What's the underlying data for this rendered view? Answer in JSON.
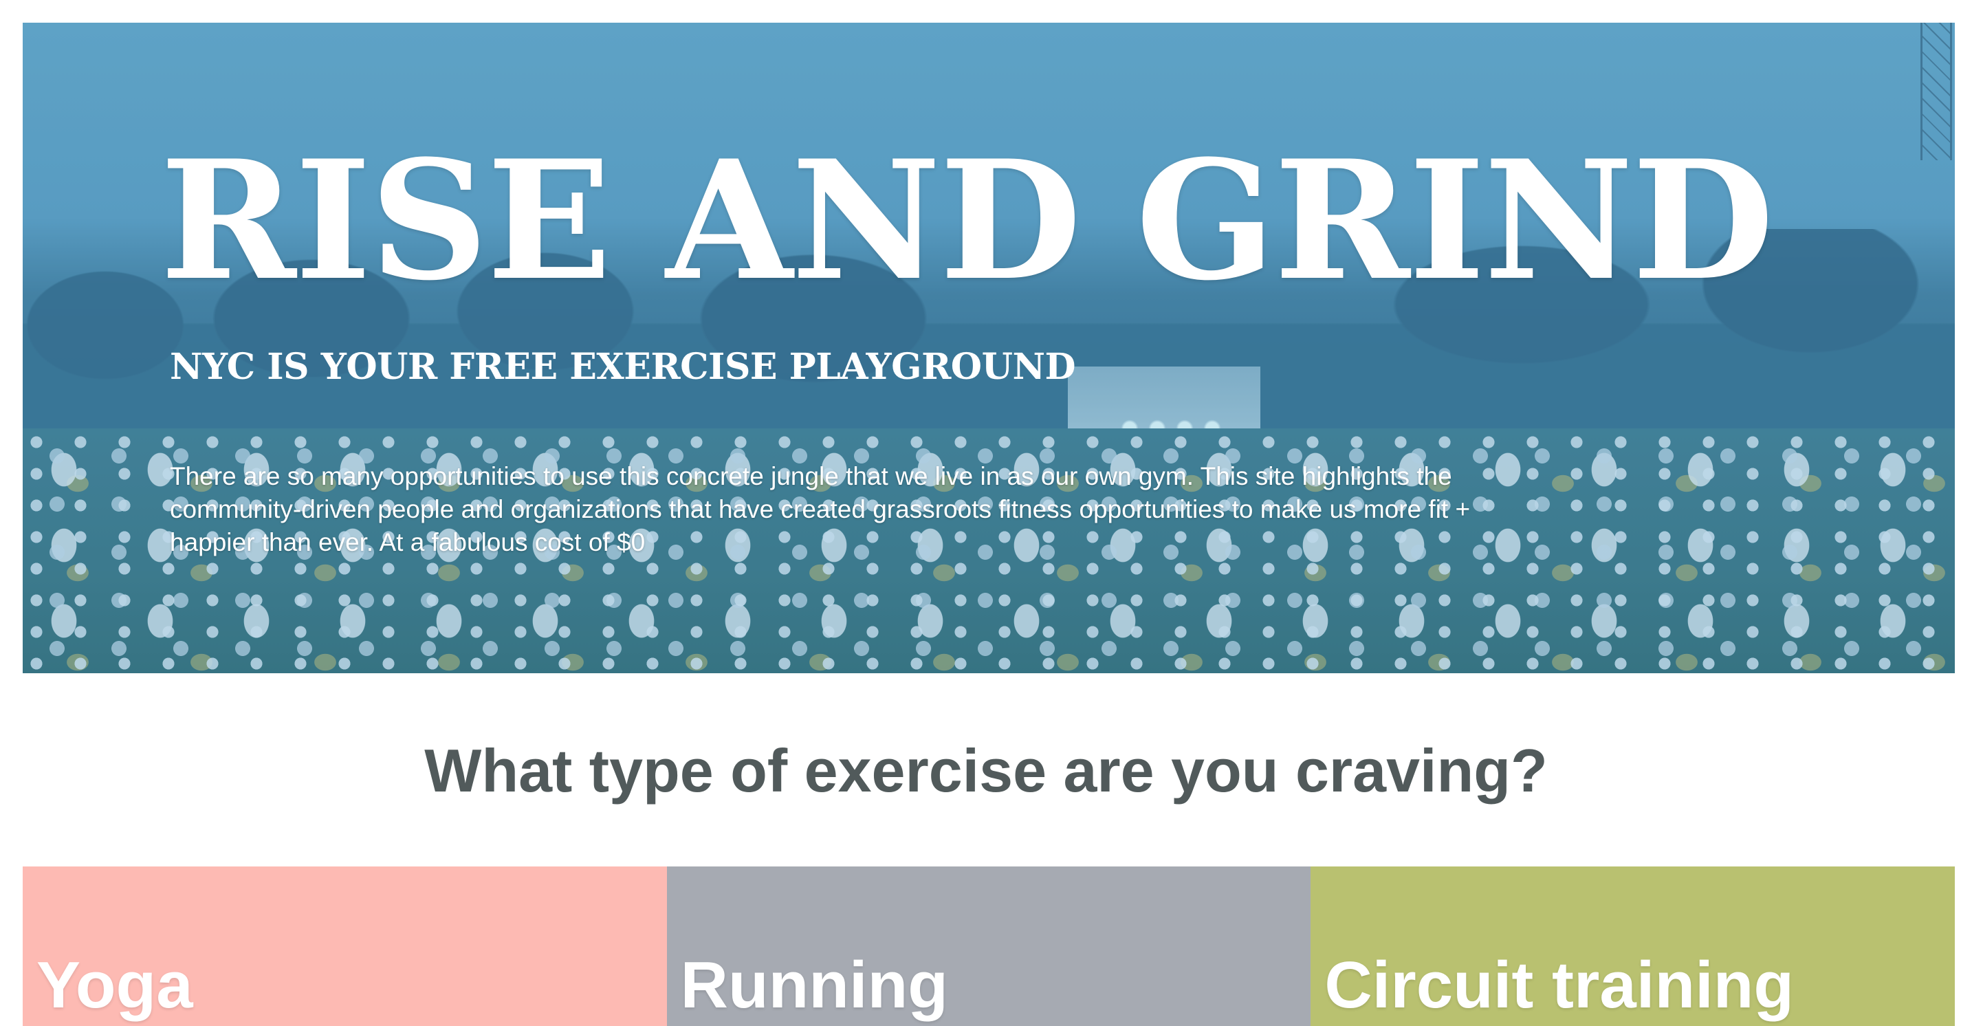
{
  "hero": {
    "title": "RISE AND GRIND",
    "subtitle": "NYC IS YOUR FREE EXERCISE PLAYGROUND",
    "description": "There are so many opportunities to use this concrete jungle that we live in as our own gym. This site highlights the community-driven people and organizations that have created grassroots fitness opportunities to make us more fit + happier than ever. At a fabulous cost of $0"
  },
  "section": {
    "heading": "What type of exercise are you craving?"
  },
  "cards": [
    {
      "label": "Yoga",
      "color": "#fdbab3"
    },
    {
      "label": "Running",
      "color": "#a6aab2"
    },
    {
      "label": "Circuit training",
      "color": "#b9c170"
    }
  ],
  "colors": {
    "heading_text": "#515a5b",
    "hero_tint": "#5a9dc2"
  }
}
